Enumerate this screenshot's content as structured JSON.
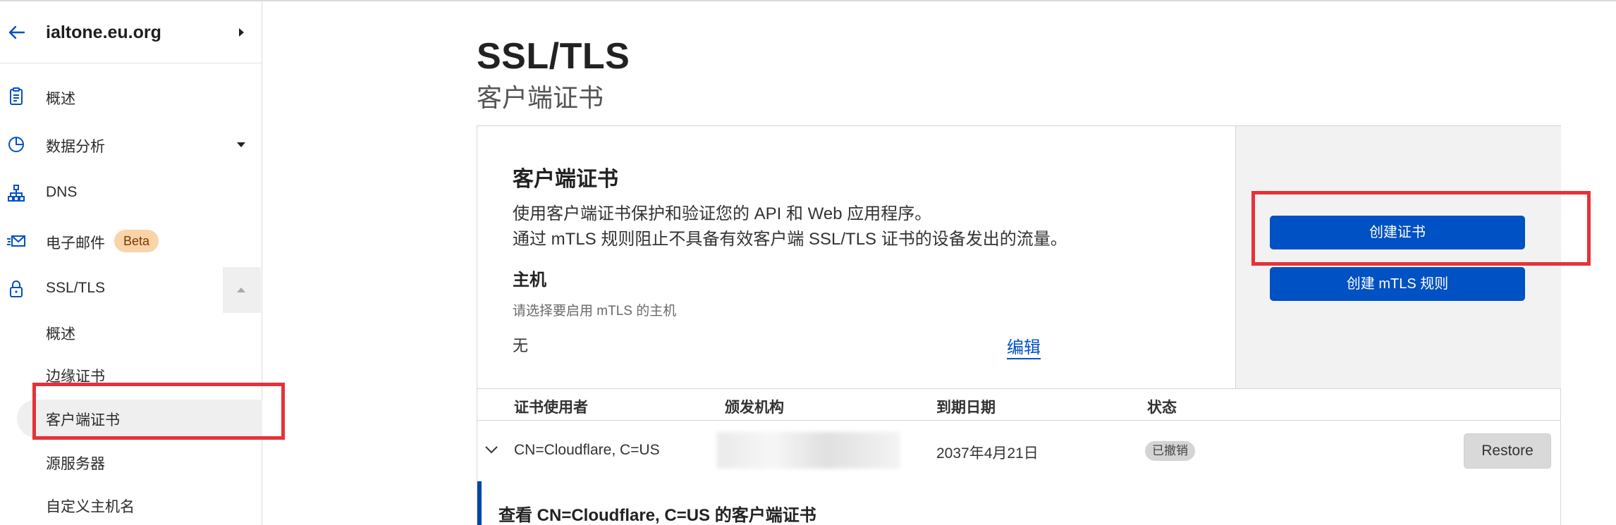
{
  "zone": {
    "name": "ialtone.eu.org"
  },
  "sidebar": {
    "items": [
      {
        "label": "概述",
        "icon": "clipboard-icon"
      },
      {
        "label": "数据分析",
        "icon": "pie-chart-icon"
      },
      {
        "label": "DNS",
        "icon": "network-icon"
      },
      {
        "label": "电子邮件",
        "icon": "mail-icon",
        "badge": "Beta"
      },
      {
        "label": "SSL/TLS",
        "icon": "lock-icon"
      }
    ],
    "sub_items": [
      {
        "label": "概述"
      },
      {
        "label": "边缘证书"
      },
      {
        "label": "客户端证书"
      },
      {
        "label": "源服务器"
      },
      {
        "label": "自定义主机名"
      }
    ]
  },
  "page": {
    "title": "SSL/TLS",
    "subtitle": "客户端证书"
  },
  "card": {
    "heading": "客户端证书",
    "desc1": "使用客户端证书保护和验证您的 API 和 Web 应用程序。",
    "desc2": "通过 mTLS 规则阻止不具备有效客户端 SSL/TLS 证书的设备发出的流量。",
    "host_heading": "主机",
    "host_help": "请选择要启用 mTLS 的主机",
    "host_value": "无",
    "edit_label": "编辑",
    "create_cert_label": "创建证书",
    "create_mtls_label": "创建 mTLS 规则"
  },
  "table": {
    "headers": [
      "证书使用者",
      "颁发机构",
      "到期日期",
      "状态"
    ],
    "rows": [
      {
        "subject": "CN=Cloudflare, C=US",
        "issuer": "",
        "expiry": "2037年4月21日",
        "status": "已撤销",
        "action": "Restore"
      }
    ]
  },
  "detail": {
    "title": "查看 CN=Cloudflare, C=US 的客户端证书"
  },
  "colors": {
    "accent": "#0051c3",
    "highlight": "#e53238",
    "badge_bg": "#fbd3a8"
  }
}
